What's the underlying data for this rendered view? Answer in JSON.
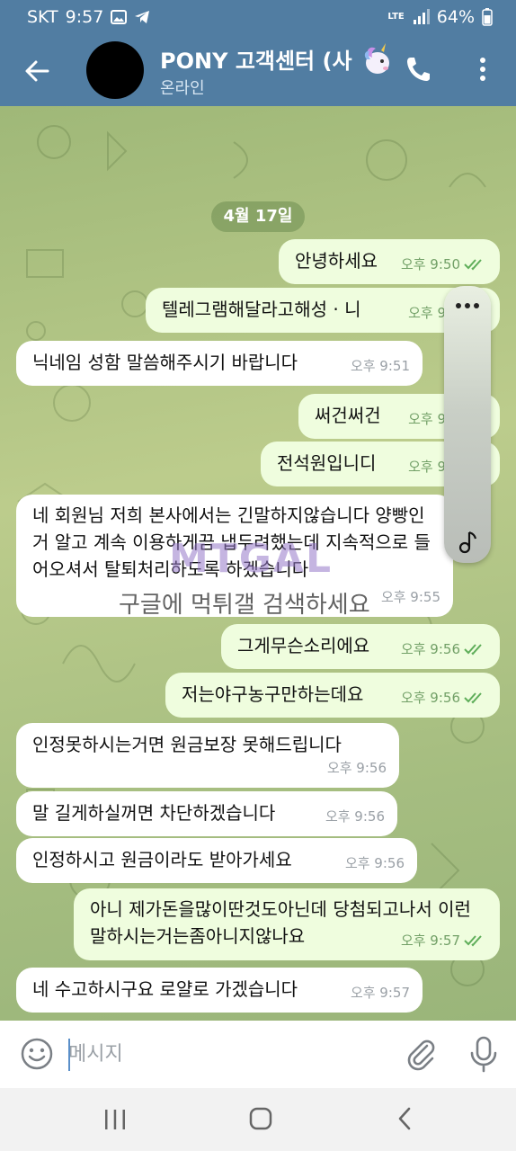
{
  "status_bar": {
    "carrier": "SKT",
    "time": "9:57",
    "network": "LTE",
    "battery": "64%"
  },
  "header": {
    "title": "PONY 고객센터 (사",
    "status": "온라인"
  },
  "date_badge": "4월 17일",
  "messages": [
    {
      "text": "안녕하세요",
      "time": "오후 9:50",
      "outgoing": true
    },
    {
      "text": "텔레그램해달라고해성 · 니",
      "time": "오후 9",
      "outgoing": true
    },
    {
      "text": "닉네임 성함 말씀해주시기 바랍니다",
      "time": "오후 9:51",
      "outgoing": false
    },
    {
      "text": "써건써건",
      "time": "오후 9",
      "outgoing": true
    },
    {
      "text": "전석원입니디",
      "time": "오후 9",
      "outgoing": true
    },
    {
      "text": "네 회원님 저희 본사에서는 긴말하지않습니다 양빵인거 알고 계속 이용하게끔 냅두려했는데 지속적으로 들어오셔서 탈퇴처리하도록 하겠습니다",
      "time": "오후 9:55",
      "outgoing": false
    },
    {
      "text": "그게무슨소리에요",
      "time": "오후 9:56",
      "outgoing": true
    },
    {
      "text": "저는야구농구만하는데요",
      "time": "오후 9:56",
      "outgoing": true
    },
    {
      "text": "인정못하시는거면 원금보장 못해드립니다",
      "time": "오후 9:56",
      "outgoing": false
    },
    {
      "text": "말 길게하실꺼면 차단하겠습니다",
      "time": "오후 9:56",
      "outgoing": false
    },
    {
      "text": "인정하시고 원금이라도 받아가세요",
      "time": "오후 9:56",
      "outgoing": false
    },
    {
      "text": "아니 제가돈을많이딴것도아닌데 당첨되고나서 이런말하시는거는좀아니지않나요",
      "time": "오후 9:57",
      "outgoing": true
    },
    {
      "text": "네 수고하시구요 로얄로 가겠습니다",
      "time": "오후 9:57",
      "outgoing": false
    }
  ],
  "watermark": {
    "logo": "MTGAL",
    "caption": "구글에 먹튀갤 검색하세요"
  },
  "input": {
    "placeholder": "메시지"
  },
  "colors": {
    "header": "#517da2",
    "outgoing_bubble": "#effdde",
    "incoming_bubble": "#ffffff",
    "check": "#5fae5a"
  },
  "icons": [
    "back-arrow-icon",
    "unicorn-icon",
    "phone-icon",
    "more-vertical-icon",
    "emoji-icon",
    "attach-icon",
    "mic-icon",
    "more-horizontal-icon",
    "music-note-icon",
    "double-check-icon",
    "recents-icon",
    "home-icon",
    "back-icon"
  ]
}
